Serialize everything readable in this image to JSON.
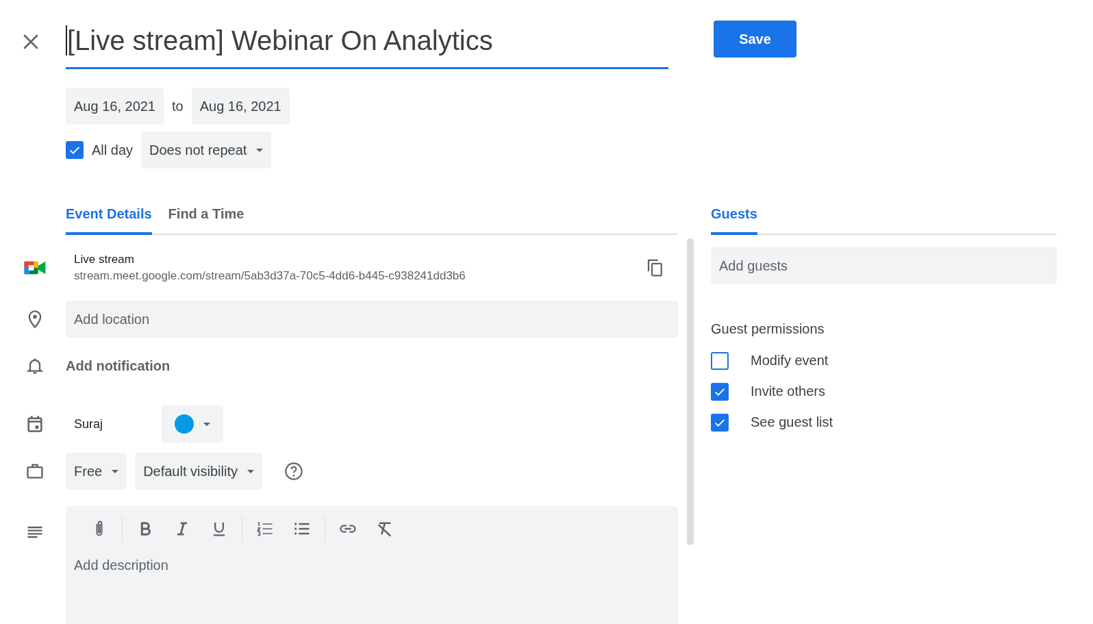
{
  "title": "[Live stream] Webinar On Analytics",
  "save": "Save",
  "start_date": "Aug 16, 2021",
  "to": "to",
  "end_date": "Aug 16, 2021",
  "all_day": {
    "label": "All day",
    "checked": true
  },
  "repeat": "Does not repeat",
  "tabs": [
    {
      "label": "Event Details",
      "selected": true
    },
    {
      "label": "Find a Time",
      "selected": false
    }
  ],
  "conference": {
    "title": "Live stream",
    "url": "stream.meet.google.com/stream/5ab3d37a-70c5-4dd6-b445-c938241dd3b6"
  },
  "location": {
    "placeholder": "Add location"
  },
  "notification": "Add notification",
  "calendar": {
    "name": "Suraj",
    "color": "#039be5"
  },
  "availability": "Free",
  "visibility": "Default visibility",
  "description": {
    "placeholder": "Add description"
  },
  "guests_tab": {
    "label": "Guests",
    "selected": true
  },
  "add_guests": {
    "placeholder": "Add guests"
  },
  "permissions": {
    "title": "Guest permissions",
    "items": [
      {
        "label": "Modify event",
        "checked": false
      },
      {
        "label": "Invite others",
        "checked": true
      },
      {
        "label": "See guest list",
        "checked": true
      }
    ]
  }
}
